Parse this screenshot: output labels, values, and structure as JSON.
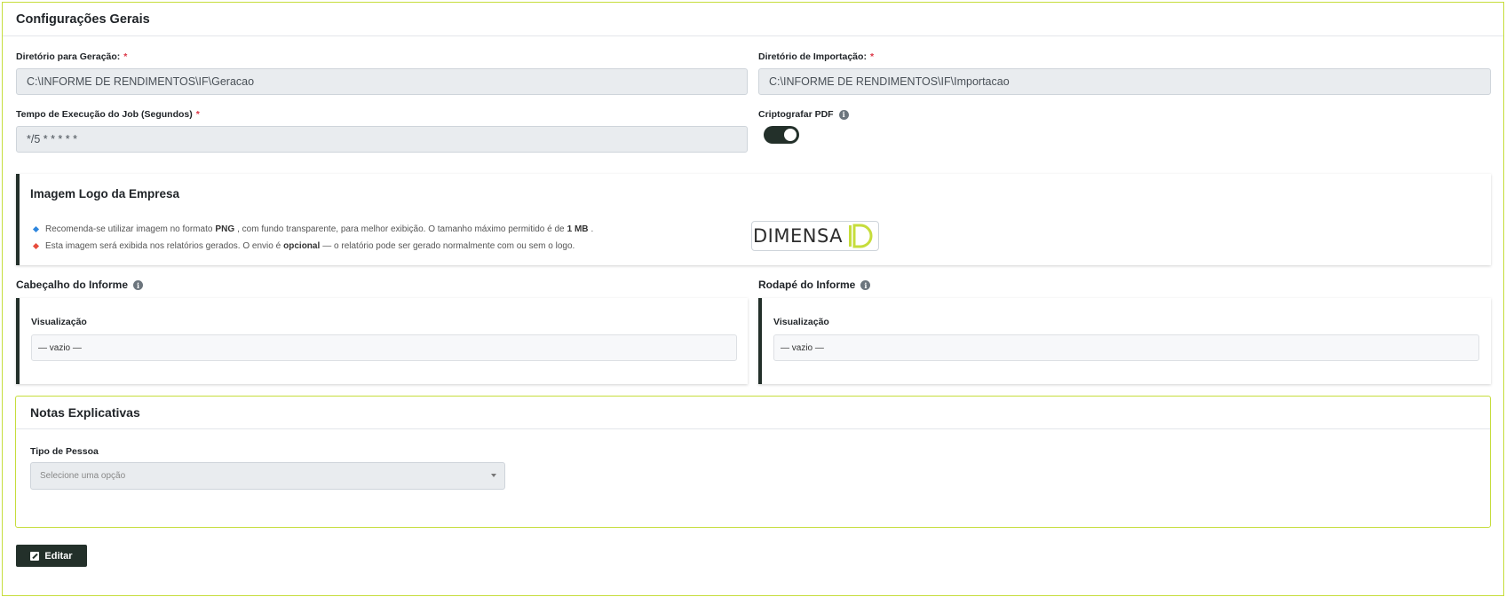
{
  "header": {
    "title": "Configurações Gerais"
  },
  "fields": {
    "geracao": {
      "label": "Diretório para Geração:",
      "required_mark": "*",
      "value": "C:\\INFORME DE RENDIMENTOS\\IF\\Geracao"
    },
    "importacao": {
      "label": "Diretório de Importação:",
      "required_mark": "*",
      "value": "C:\\INFORME DE RENDIMENTOS\\IF\\Importacao"
    },
    "tempo": {
      "label": "Tempo de Execução do Job (Segundos)",
      "required_mark": "*",
      "value": "*/5 * * * * *"
    },
    "criptografar": {
      "label": "Criptografar PDF",
      "enabled": true
    }
  },
  "logo_card": {
    "title": "Imagem Logo da Empresa",
    "bullet1": {
      "pre": "Recomenda-se utilizar imagem no formato",
      "b1": "PNG",
      "mid": ", com fundo transparente, para melhor exibição. O tamanho máximo permitido é de",
      "b2": "1 MB",
      "post": ".",
      "color": "#2e86de"
    },
    "bullet2": {
      "pre": "Esta imagem será exibida nos relatórios gerados. O envio é",
      "b1": "opcional",
      "post": "— o relatório pode ser gerado normalmente com ou sem o logo.",
      "color": "#e74c3c"
    },
    "logo_text": "DIMENSA",
    "logo_accent": "#c6dd3c"
  },
  "cabecalho": {
    "title": "Cabeçalho do Informe",
    "preview_label": "Visualização",
    "preview_value": "— vazio —"
  },
  "rodape": {
    "title": "Rodapé do Informe",
    "preview_label": "Visualização",
    "preview_value": "— vazio —"
  },
  "notas": {
    "title": "Notas Explicativas",
    "tipo_label": "Tipo de Pessoa",
    "tipo_placeholder": "Selecione uma opção"
  },
  "actions": {
    "edit_label": "Editar"
  },
  "icons": {
    "info": "info-icon",
    "edit": "edit-icon",
    "caret": "caret-down-icon"
  },
  "colors": {
    "accent": "#c6dd3c",
    "dark": "#23302a",
    "required": "#dc3545"
  }
}
